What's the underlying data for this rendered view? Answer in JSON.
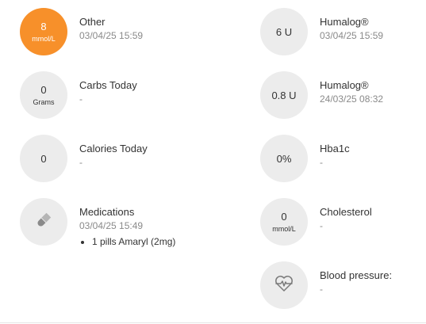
{
  "colors": {
    "accent": "#f7902a",
    "circle_bg": "#ececec",
    "muted_text": "#8a8a8a"
  },
  "left": [
    {
      "value": "8",
      "unit": "mmol/L",
      "title": "Other",
      "sub": "03/04/25 15:59"
    },
    {
      "value": "0",
      "unit": "Grams",
      "title": "Carbs Today",
      "sub": "-"
    },
    {
      "value": "0",
      "unit": "",
      "title": "Calories Today",
      "sub": "-"
    },
    {
      "icon": "pill-icon",
      "title": "Medications",
      "sub": "03/04/25 15:49",
      "items": [
        "1 pills Amaryl (2mg)"
      ]
    }
  ],
  "right": [
    {
      "value": "6 U",
      "unit": "",
      "title": "Humalog®",
      "sub": "03/04/25 15:59"
    },
    {
      "value": "0.8 U",
      "unit": "",
      "title": "Humalog®",
      "sub": "24/03/25 08:32"
    },
    {
      "value": "0%",
      "unit": "",
      "title": "Hba1c",
      "sub": "-"
    },
    {
      "value": "0",
      "unit": "mmol/L",
      "title": "Cholesterol",
      "sub": "-"
    },
    {
      "icon": "heart-pulse-icon",
      "title": "Blood pressure:",
      "sub": "-"
    }
  ]
}
